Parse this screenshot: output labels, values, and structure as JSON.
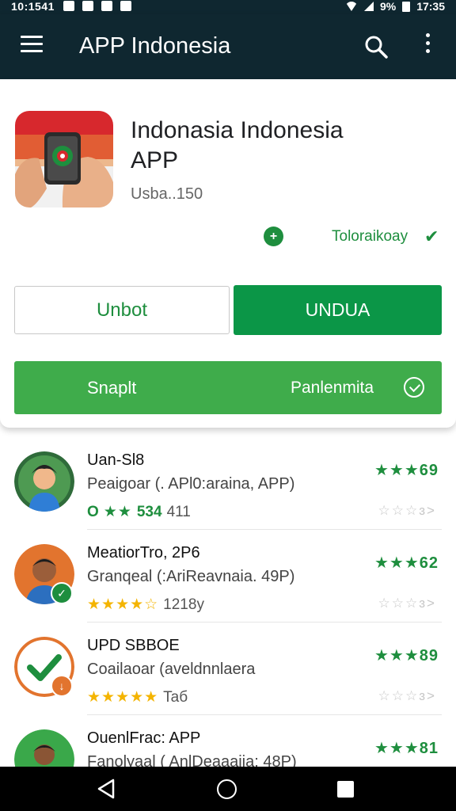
{
  "status_bar": {
    "time_left": "10:1541",
    "battery": "9%",
    "time_right": "17:35"
  },
  "app_bar": {
    "title": "APP Indonesia",
    "menu_icon": "menu-icon",
    "search_icon": "search-icon",
    "more_icon": "more-vert-icon"
  },
  "app_card": {
    "name": "Indonasia Indonesia APP",
    "subtitle": "Usba..150",
    "verified_label": "Toloraikoay",
    "install_button_outline": "Unbot",
    "install_button_filled": "UNDUA",
    "wide_button_left": "Snaplt",
    "wide_button_right": "Panlenmita",
    "colors": {
      "primary": "#0b9647",
      "secondary": "#3fac4b",
      "appbar": "#0f2730"
    }
  },
  "list": {
    "items": [
      {
        "title": "Uan-Sl8",
        "subtitle": "Peaigoar (. APl0:araina, APP)",
        "meta_prefix": "O",
        "meta_stars": "★★",
        "meta_count": "534",
        "meta_extra": "411",
        "rating": "★★★69",
        "rating_secondary": "☆☆☆ɜ>",
        "badge": ""
      },
      {
        "title": "MeatiorTro, 2P6",
        "subtitle": "Granqeal (:AriReavnaia. 49P)",
        "meta_prefix": "",
        "meta_stars": "★★★★☆",
        "meta_count": "",
        "meta_extra": "1218y",
        "rating": "★★★62",
        "rating_secondary": "☆☆☆ɜ>",
        "badge": "check"
      },
      {
        "title": "UPD SBBOE",
        "subtitle": "Coailaoar (aveldnnlaera",
        "meta_prefix": "",
        "meta_stars": "★★★★★",
        "meta_count": "",
        "meta_extra": "Taб",
        "rating": "★★★89",
        "rating_secondary": "☆☆☆ɜ>",
        "badge": "down"
      },
      {
        "title": "OuenlFrac: APP",
        "subtitle": "Fanolyaal ( AnlDeaaaiia: 48P)",
        "meta_prefix": "",
        "meta_stars": "",
        "meta_count": "",
        "meta_extra": "",
        "rating": "★★★81",
        "rating_secondary": "",
        "badge": ""
      }
    ]
  },
  "nav_bar": {
    "back_icon": "back-icon",
    "home_icon": "home-icon",
    "recent_icon": "recents-icon"
  }
}
